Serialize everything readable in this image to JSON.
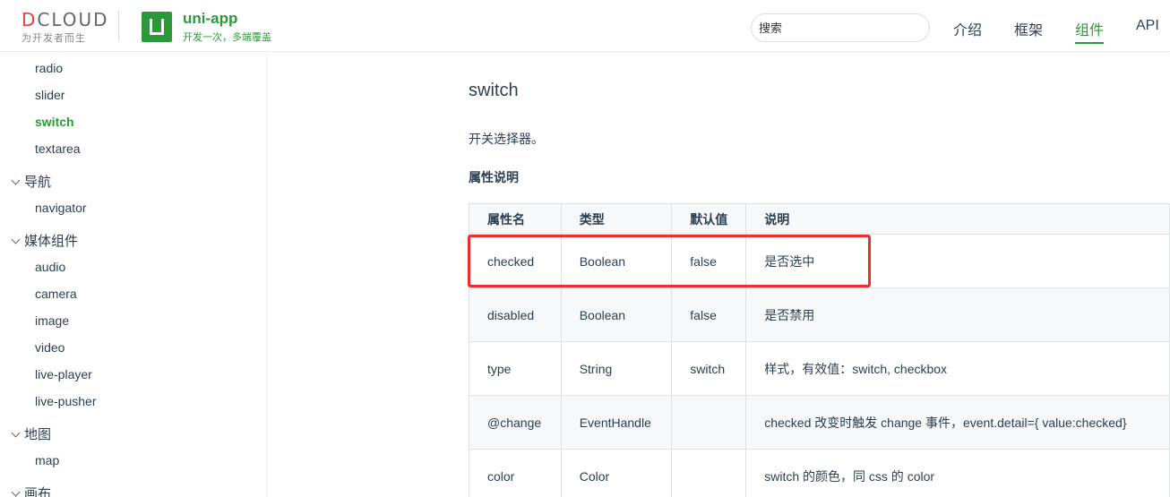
{
  "header": {
    "dcloud_logo_prefix": "D",
    "dcloud_logo_rest": "CLOUD",
    "dcloud_tagline": "为开发者而生",
    "app_title": "uni-app",
    "app_subtitle": "开发一次，多端覆盖",
    "search_placeholder": "搜索",
    "nav": [
      "介绍",
      "框架",
      "组件",
      "API"
    ],
    "active_nav": "组件"
  },
  "sidebar": {
    "items_top": [
      "radio",
      "slider",
      "switch",
      "textarea"
    ],
    "active_item": "switch",
    "groups": [
      {
        "label": "导航",
        "items": [
          "navigator"
        ]
      },
      {
        "label": "媒体组件",
        "items": [
          "audio",
          "camera",
          "image",
          "video",
          "live-player",
          "live-pusher"
        ]
      },
      {
        "label": "地图",
        "items": [
          "map"
        ]
      },
      {
        "label": "画布",
        "items": []
      }
    ]
  },
  "main": {
    "title": "switch",
    "description": "开关选择器。",
    "section_title": "属性说明",
    "table": {
      "headers": [
        "属性名",
        "类型",
        "默认值",
        "说明"
      ],
      "rows": [
        [
          "checked",
          "Boolean",
          "false",
          "是否选中"
        ],
        [
          "disabled",
          "Boolean",
          "false",
          "是否禁用"
        ],
        [
          "type",
          "String",
          "switch",
          "样式，有效值：switch, checkbox"
        ],
        [
          "@change",
          "EventHandle",
          "",
          "checked 改变时触发 change 事件，event.detail={ value:checked}"
        ],
        [
          "color",
          "Color",
          "",
          "switch 的颜色，同 css 的 color"
        ]
      ]
    }
  },
  "colors": {
    "brand_green": "#2b9939",
    "highlight_red": "#e8302c"
  }
}
